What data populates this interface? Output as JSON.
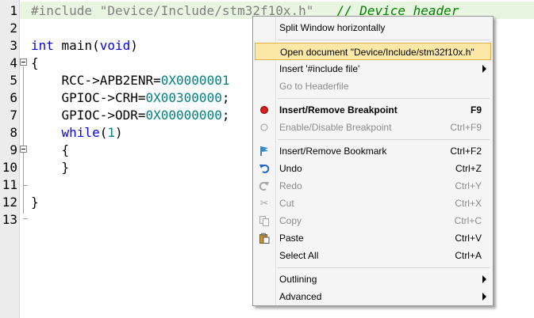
{
  "editor": {
    "line_numbers": [
      "1",
      "2",
      "3",
      "4",
      "5",
      "6",
      "7",
      "8",
      "9",
      "10",
      "11",
      "12",
      "13"
    ],
    "lines": {
      "l1_pp": "#include \"Device/Include/stm32f10x.h\"",
      "l1_cmt": "   // Device header",
      "l3_kw1": "int",
      "l3_mid": " main(",
      "l3_kw2": "void",
      "l3_end": ")",
      "l4": "{",
      "l5_a": "    RCC->APB2ENR=",
      "l5_n": "0X0000001",
      "l6_a": "    GPIOC->CRH=",
      "l6_n": "0X00300000",
      "l6_e": ";",
      "l7_a": "    GPIOC->ODR=",
      "l7_n": "0X00000000",
      "l7_e": ";",
      "l8_kw": "    while",
      "l8_p1": "(",
      "l8_n": "1",
      "l8_p2": ")",
      "l9": "    {",
      "l10": "    }",
      "l12": "}"
    }
  },
  "context_menu": {
    "split_window": "Split Window horizontally",
    "open_document": "Open document \"Device/Include/stm32f10x.h\"",
    "insert_include": "Insert '#include file'",
    "go_to_headerfile": "Go to Headerfile",
    "insert_remove_breakpoint": "Insert/Remove Breakpoint",
    "insert_remove_breakpoint_sc": "F9",
    "enable_disable_breakpoint": "Enable/Disable Breakpoint",
    "enable_disable_breakpoint_sc": "Ctrl+F9",
    "insert_remove_bookmark": "Insert/Remove Bookmark",
    "insert_remove_bookmark_sc": "Ctrl+F2",
    "undo": "Undo",
    "undo_sc": "Ctrl+Z",
    "redo": "Redo",
    "redo_sc": "Ctrl+Y",
    "cut": "Cut",
    "cut_sc": "Ctrl+X",
    "copy": "Copy",
    "copy_sc": "Ctrl+C",
    "paste": "Paste",
    "paste_sc": "Ctrl+V",
    "select_all": "Select All",
    "select_all_sc": "Ctrl+A",
    "outlining": "Outlining",
    "advanced": "Advanced"
  },
  "icons": {
    "breakpoint": "red-dot-icon",
    "breakpoint_disabled": "grey-circle-icon",
    "bookmark": "flag-icon",
    "undo": "undo-arrow-icon",
    "redo": "redo-arrow-icon",
    "cut": "scissors-icon",
    "copy": "copy-icon",
    "paste": "paste-icon"
  },
  "colors": {
    "keyword": "#0000ff",
    "number": "#008080",
    "comment": "#008000",
    "preprocessor": "#808080",
    "menu_highlight": "#fce8a6"
  }
}
